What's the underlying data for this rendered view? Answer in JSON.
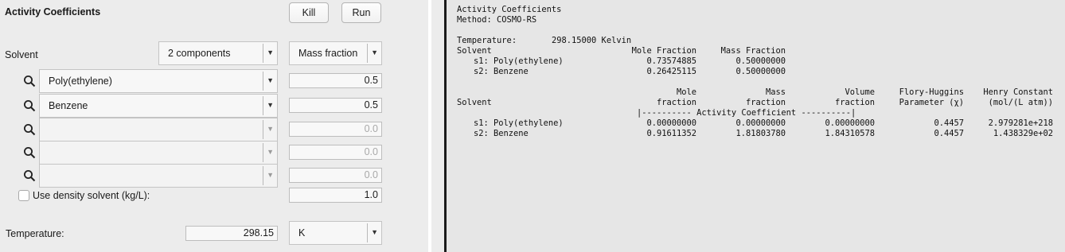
{
  "left": {
    "title": "Activity Coefficients",
    "kill_label": "Kill",
    "run_label": "Run",
    "solvent_label": "Solvent",
    "components_select": "2 components",
    "fraction_type_select": "Mass fraction",
    "compounds": [
      {
        "name": "Poly(ethylene)",
        "value": "0.5",
        "enabled": true
      },
      {
        "name": "Benzene",
        "value": "0.5",
        "enabled": true
      },
      {
        "name": "",
        "value": "0.0",
        "enabled": false
      },
      {
        "name": "",
        "value": "0.0",
        "enabled": false
      },
      {
        "name": "",
        "value": "0.0",
        "enabled": false
      }
    ],
    "density_checkbox_label": "Use density solvent (kg/L):",
    "density_checked": false,
    "density_value": "1.0",
    "temperature_label": "Temperature:",
    "temperature_value": "298.15",
    "temperature_unit": "K"
  },
  "output": {
    "line1": "Activity Coefficients",
    "line2": "Method: COSMO-RS",
    "temp_label": "Temperature:",
    "temp_value": "298.15000 Kelvin",
    "t1_header_solvent": "Solvent",
    "t1_header_mole": "Mole Fraction",
    "t1_header_mass": "Mass Fraction",
    "t1_rows": [
      {
        "name": "s1: Poly(ethylene)",
        "mole": "0.73574885",
        "mass": "0.50000000"
      },
      {
        "name": "s2: Benzene",
        "mole": "0.26425115",
        "mass": "0.50000000"
      }
    ],
    "t2_h1_mole": "Mole",
    "t2_h1_mass": "Mass",
    "t2_h1_volume": "Volume",
    "t2_h1_flory": "Flory-Huggins",
    "t2_h1_henry": "Henry Constant",
    "t2_h2_solvent": "Solvent",
    "t2_h2_mole": "fraction",
    "t2_h2_mass": "fraction",
    "t2_h2_volume": "fraction",
    "t2_h2_flory": "Parameter (χ)",
    "t2_h2_henry": "(mol/(L atm))",
    "t2_activity_band": "|---------- Activity Coefficient ----------|",
    "t2_rows": [
      {
        "name": "s1: Poly(ethylene)",
        "mole": "0.00000000",
        "mass": "0.00000000",
        "volume": "0.00000000",
        "flory": "0.4457",
        "henry": "2.979281e+218"
      },
      {
        "name": "s2: Benzene",
        "mole": "0.91611352",
        "mass": "1.81803780",
        "volume": "1.84310578",
        "flory": "0.4457",
        "henry": "1.438329e+02"
      }
    ]
  }
}
